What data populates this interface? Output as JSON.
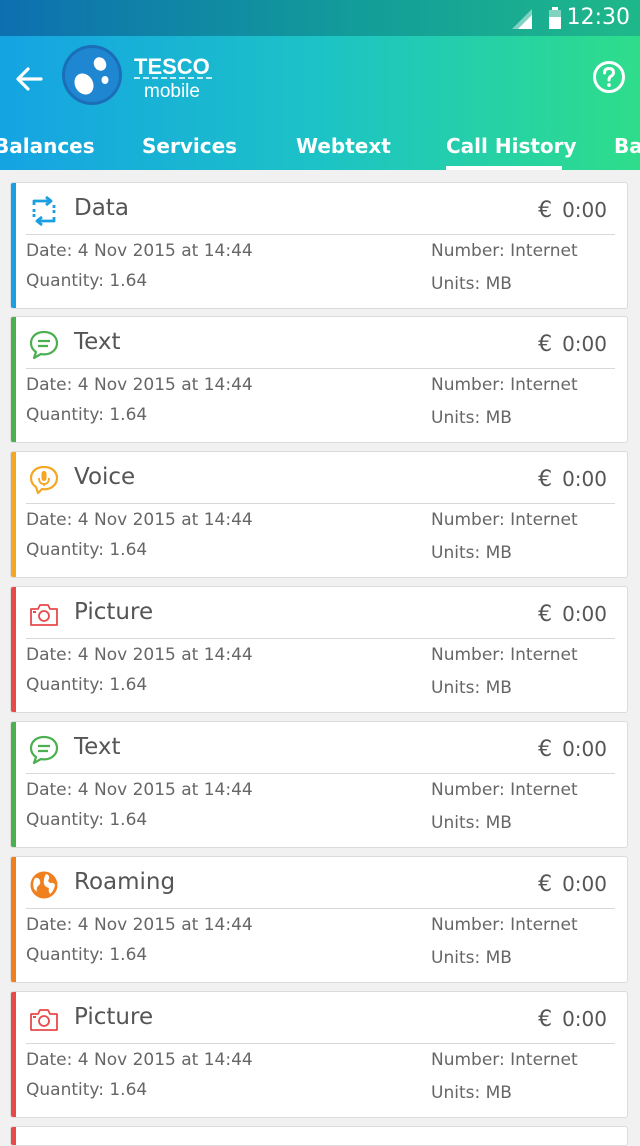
{
  "status_bar": {
    "time": "12:30"
  },
  "header": {
    "brand_top": "TESCO",
    "brand_bottom": "mobile"
  },
  "tabs": [
    {
      "label": "Balances"
    },
    {
      "label": "Services"
    },
    {
      "label": "Webtext"
    },
    {
      "label": "Call History",
      "active": true
    },
    {
      "label": "Ba"
    }
  ],
  "colors": {
    "data": "#1a9fe0",
    "text": "#4caf50",
    "voice": "#f5a623",
    "picture": "#e84a4a",
    "roaming": "#f07f1d"
  },
  "records": [
    {
      "type": "Data",
      "icon": "data-transfer-icon",
      "currency": "€",
      "cost": "0:00",
      "date": "Date: 4 Nov 2015 at 14:44",
      "quantity": "Quantity: 1.64",
      "number": "Number: Internet",
      "units": "Units: MB"
    },
    {
      "type": "Text",
      "icon": "message-icon",
      "currency": "€",
      "cost": "0:00",
      "date": "Date: 4 Nov 2015 at 14:44",
      "quantity": "Quantity: 1.64",
      "number": "Number: Internet",
      "units": "Units: MB"
    },
    {
      "type": "Voice",
      "icon": "microphone-icon",
      "currency": "€",
      "cost": "0:00",
      "date": "Date: 4 Nov 2015 at 14:44",
      "quantity": "Quantity: 1.64",
      "number": "Number: Internet",
      "units": "Units: MB"
    },
    {
      "type": "Picture",
      "icon": "camera-icon",
      "currency": "€",
      "cost": "0:00",
      "date": "Date: 4 Nov 2015 at 14:44",
      "quantity": "Quantity: 1.64",
      "number": "Number: Internet",
      "units": "Units: MB"
    },
    {
      "type": "Text",
      "icon": "message-icon",
      "currency": "€",
      "cost": "0:00",
      "date": "Date: 4 Nov 2015 at 14:44",
      "quantity": "Quantity: 1.64",
      "number": "Number: Internet",
      "units": "Units: MB"
    },
    {
      "type": "Roaming",
      "icon": "globe-icon",
      "currency": "€",
      "cost": "0:00",
      "date": "Date: 4 Nov 2015 at 14:44",
      "quantity": "Quantity: 1.64",
      "number": "Number: Internet",
      "units": "Units: MB"
    },
    {
      "type": "Picture",
      "icon": "camera-icon",
      "currency": "€",
      "cost": "0:00",
      "date": "Date: 4 Nov 2015 at 14:44",
      "quantity": "Quantity: 1.64",
      "number": "Number: Internet",
      "units": "Units: MB"
    }
  ]
}
